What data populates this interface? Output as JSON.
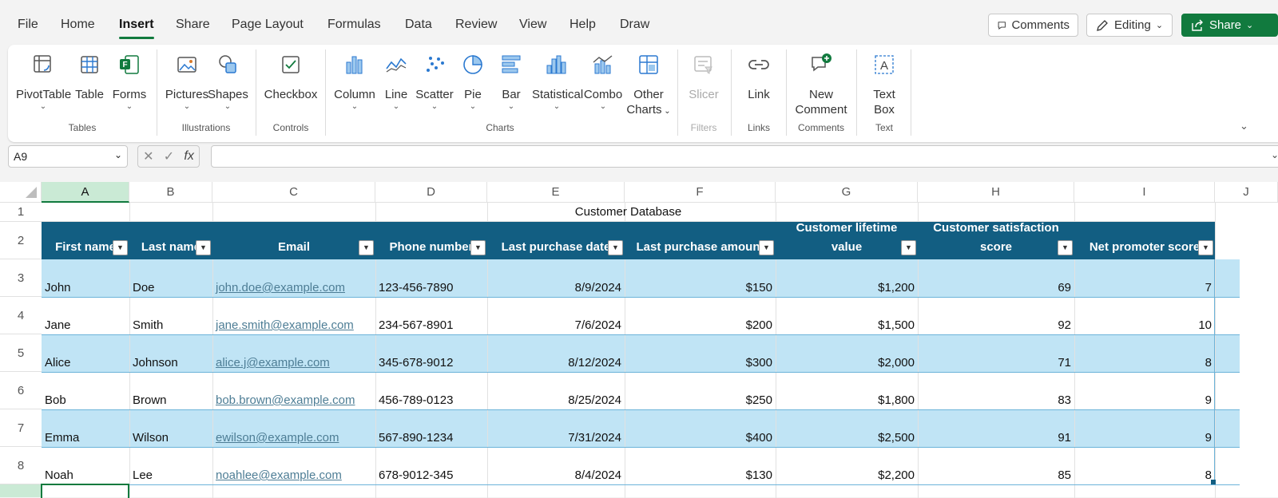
{
  "menu": {
    "tabs": [
      "File",
      "Home",
      "Insert",
      "Share",
      "Page Layout",
      "Formulas",
      "Data",
      "Review",
      "View",
      "Help",
      "Draw"
    ],
    "active": "Insert",
    "comments_label": "Comments",
    "editing_label": "Editing",
    "share_label": "Share"
  },
  "ribbon": {
    "buttons": {
      "pivottable": "PivotTable",
      "table": "Table",
      "forms": "Forms",
      "pictures": "Pictures",
      "shapes": "Shapes",
      "checkbox": "Checkbox",
      "column": "Column",
      "line": "Line",
      "scatter": "Scatter",
      "pie": "Pie",
      "bar": "Bar",
      "statistical": "Statistical",
      "combo": "Combo",
      "other_charts_1": "Other",
      "other_charts_2": "Charts",
      "slicer": "Slicer",
      "link": "Link",
      "new_comment_1": "New",
      "new_comment_2": "Comment",
      "text_box_1": "Text",
      "text_box_2": "Box"
    },
    "groups": {
      "tables": "Tables",
      "illustrations": "Illustrations",
      "controls": "Controls",
      "charts": "Charts",
      "filters": "Filters",
      "links": "Links",
      "comments": "Comments",
      "text": "Text"
    }
  },
  "formula_bar": {
    "name_box": "A9",
    "fx": "fx",
    "formula": ""
  },
  "sheet": {
    "columns": [
      "A",
      "B",
      "C",
      "D",
      "E",
      "F",
      "G",
      "H",
      "I",
      "J"
    ],
    "selected_column": "A",
    "rows": [
      "1",
      "2",
      "3",
      "4",
      "5",
      "6",
      "7",
      "8"
    ],
    "title": "Customer Database",
    "headers": {
      "first_name": "First name",
      "last_name": "Last name",
      "email": "Email",
      "phone": "Phone number",
      "last_purchase_date": "Last purchase date",
      "last_purchase_amount": "Last purchase amount",
      "clv_1": "Customer lifetime",
      "clv_2": "value",
      "csat_1": "Customer satisfaction",
      "csat_2": "score",
      "nps": "Net promoter score"
    },
    "records": [
      {
        "first": "John",
        "last": "Doe",
        "email": "john.doe@example.com",
        "phone": "123-456-7890",
        "date": "8/9/2024",
        "amount": "$150",
        "clv": "$1,200",
        "csat": "69",
        "nps": "7"
      },
      {
        "first": "Jane",
        "last": "Smith",
        "email": "jane.smith@example.com",
        "phone": "234-567-8901",
        "date": "7/6/2024",
        "amount": "$200",
        "clv": "$1,500",
        "csat": "92",
        "nps": "10"
      },
      {
        "first": "Alice",
        "last": "Johnson",
        "email": "alice.j@example.com",
        "phone": "345-678-9012",
        "date": "8/12/2024",
        "amount": "$300",
        "clv": "$2,000",
        "csat": "71",
        "nps": "8"
      },
      {
        "first": "Bob",
        "last": "Brown",
        "email": "bob.brown@example.com",
        "phone": "456-789-0123",
        "date": "8/25/2024",
        "amount": "$250",
        "clv": "$1,800",
        "csat": "83",
        "nps": "9"
      },
      {
        "first": "Emma",
        "last": "Wilson",
        "email": "ewilson@example.com",
        "phone": "567-890-1234",
        "date": "7/31/2024",
        "amount": "$400",
        "clv": "$2,500",
        "csat": "91",
        "nps": "9"
      },
      {
        "first": "Noah",
        "last": "Lee",
        "email": "noahlee@example.com",
        "phone": "678-9012-345",
        "date": "8/4/2024",
        "amount": "$130",
        "clv": "$2,200",
        "csat": "85",
        "nps": "8"
      }
    ]
  },
  "colors": {
    "accent": "#117a3e",
    "table_header": "#125e82",
    "band": "#c0e4f5",
    "link": "#4d7d95"
  }
}
